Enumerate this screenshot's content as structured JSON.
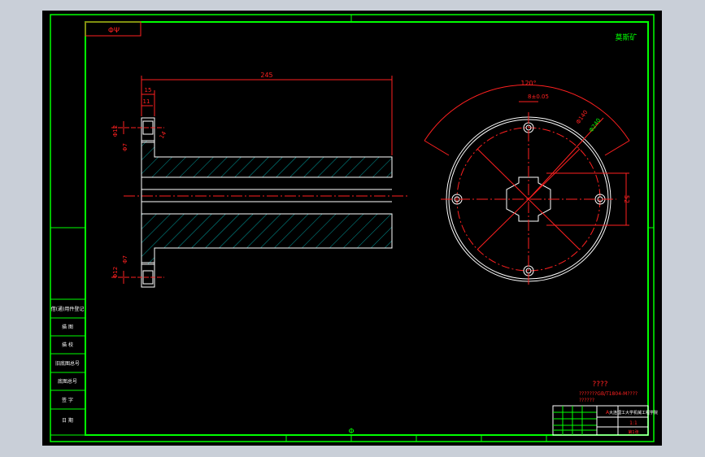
{
  "colors": {
    "background": "#c9cfd8",
    "sheet": "#000000",
    "border": "#00ff00",
    "dimension": "#ff2020",
    "outline": "#ffffff",
    "hatch": "#00c8c8"
  },
  "drawing": {
    "top_left_tag": "ΦΨ",
    "top_right_tag": "莫斯矿",
    "dimensions": {
      "overall_length": "245",
      "flange_width": "15",
      "flange_step": "11",
      "hole_dia_top": "Φ12",
      "hole_dia_bottom": "Φ12",
      "bolt_top": "Φ7",
      "bolt_bottom": "Φ7",
      "chamfer": "14",
      "angle": "120°",
      "keyway": "8±0.05",
      "pcd_small": "Φ140",
      "pcd_large": "Φ240",
      "bore_height": "52"
    },
    "notes": {
      "title": "????",
      "line1": "???????GB/T1804-M????",
      "line2": "??????"
    },
    "title_block": {
      "company": "大连理工大学机械工程学院",
      "cell_a": "A",
      "cell_b": "1:1",
      "cell_c": "第1张"
    },
    "left_table": [
      "借(通)用件登记",
      "描 图",
      "描 校",
      "旧底图总号",
      "底图总号",
      "签 字",
      "日 期"
    ],
    "bottom_center_tag": "Φ"
  }
}
